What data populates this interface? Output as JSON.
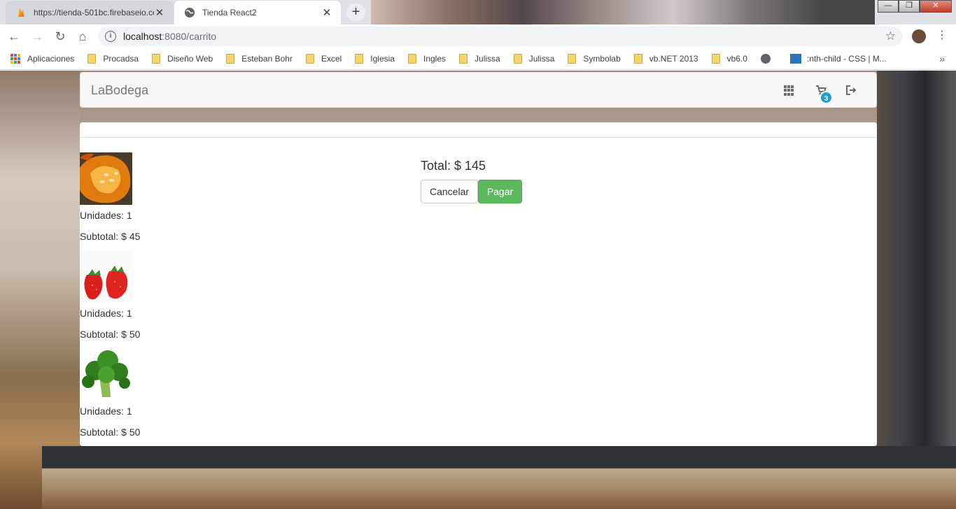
{
  "browser": {
    "tabs": [
      {
        "title": "https://tienda-501bc.firebaseio.co",
        "active": false,
        "favicon": "firebase-icon"
      },
      {
        "title": "Tienda React2",
        "active": true,
        "favicon": "globe-icon"
      }
    ],
    "new_tab_label": "+",
    "url_host": "localhost",
    "url_path": ":8080/carrito",
    "bookmarks": [
      "Aplicaciones",
      "Procadsa",
      "Diseño Web",
      "Esteban Bohr",
      "Excel",
      "Iglesia",
      "Ingles",
      "Julissa",
      "Julissa",
      "Symbolab",
      "vb.NET 2013",
      "vb6.0",
      "",
      ":nth-child - CSS | M..."
    ],
    "bookmarks_more": "»"
  },
  "navbar": {
    "brand": "LaBodega",
    "cart_count": "3",
    "icons": [
      "grid-icon",
      "shopping-cart-icon",
      "logout-icon"
    ]
  },
  "cart": {
    "items": [
      {
        "image": "pumpkin",
        "units": "Unidades: 1",
        "subtotal": "Subtotal: $ 45"
      },
      {
        "image": "strawberries",
        "units": "Unidades: 1",
        "subtotal": "Subtotal: $ 50"
      },
      {
        "image": "broccoli",
        "units": "Unidades: 1",
        "subtotal": "Subtotal: $ 50"
      }
    ],
    "total": "Total: $ 145",
    "cancel_label": "Cancelar",
    "pay_label": "Pagar"
  },
  "colors": {
    "pay_button": "#5cb85c",
    "badge": "#1f9ed3",
    "navbar_bg": "#f8f8f8"
  }
}
